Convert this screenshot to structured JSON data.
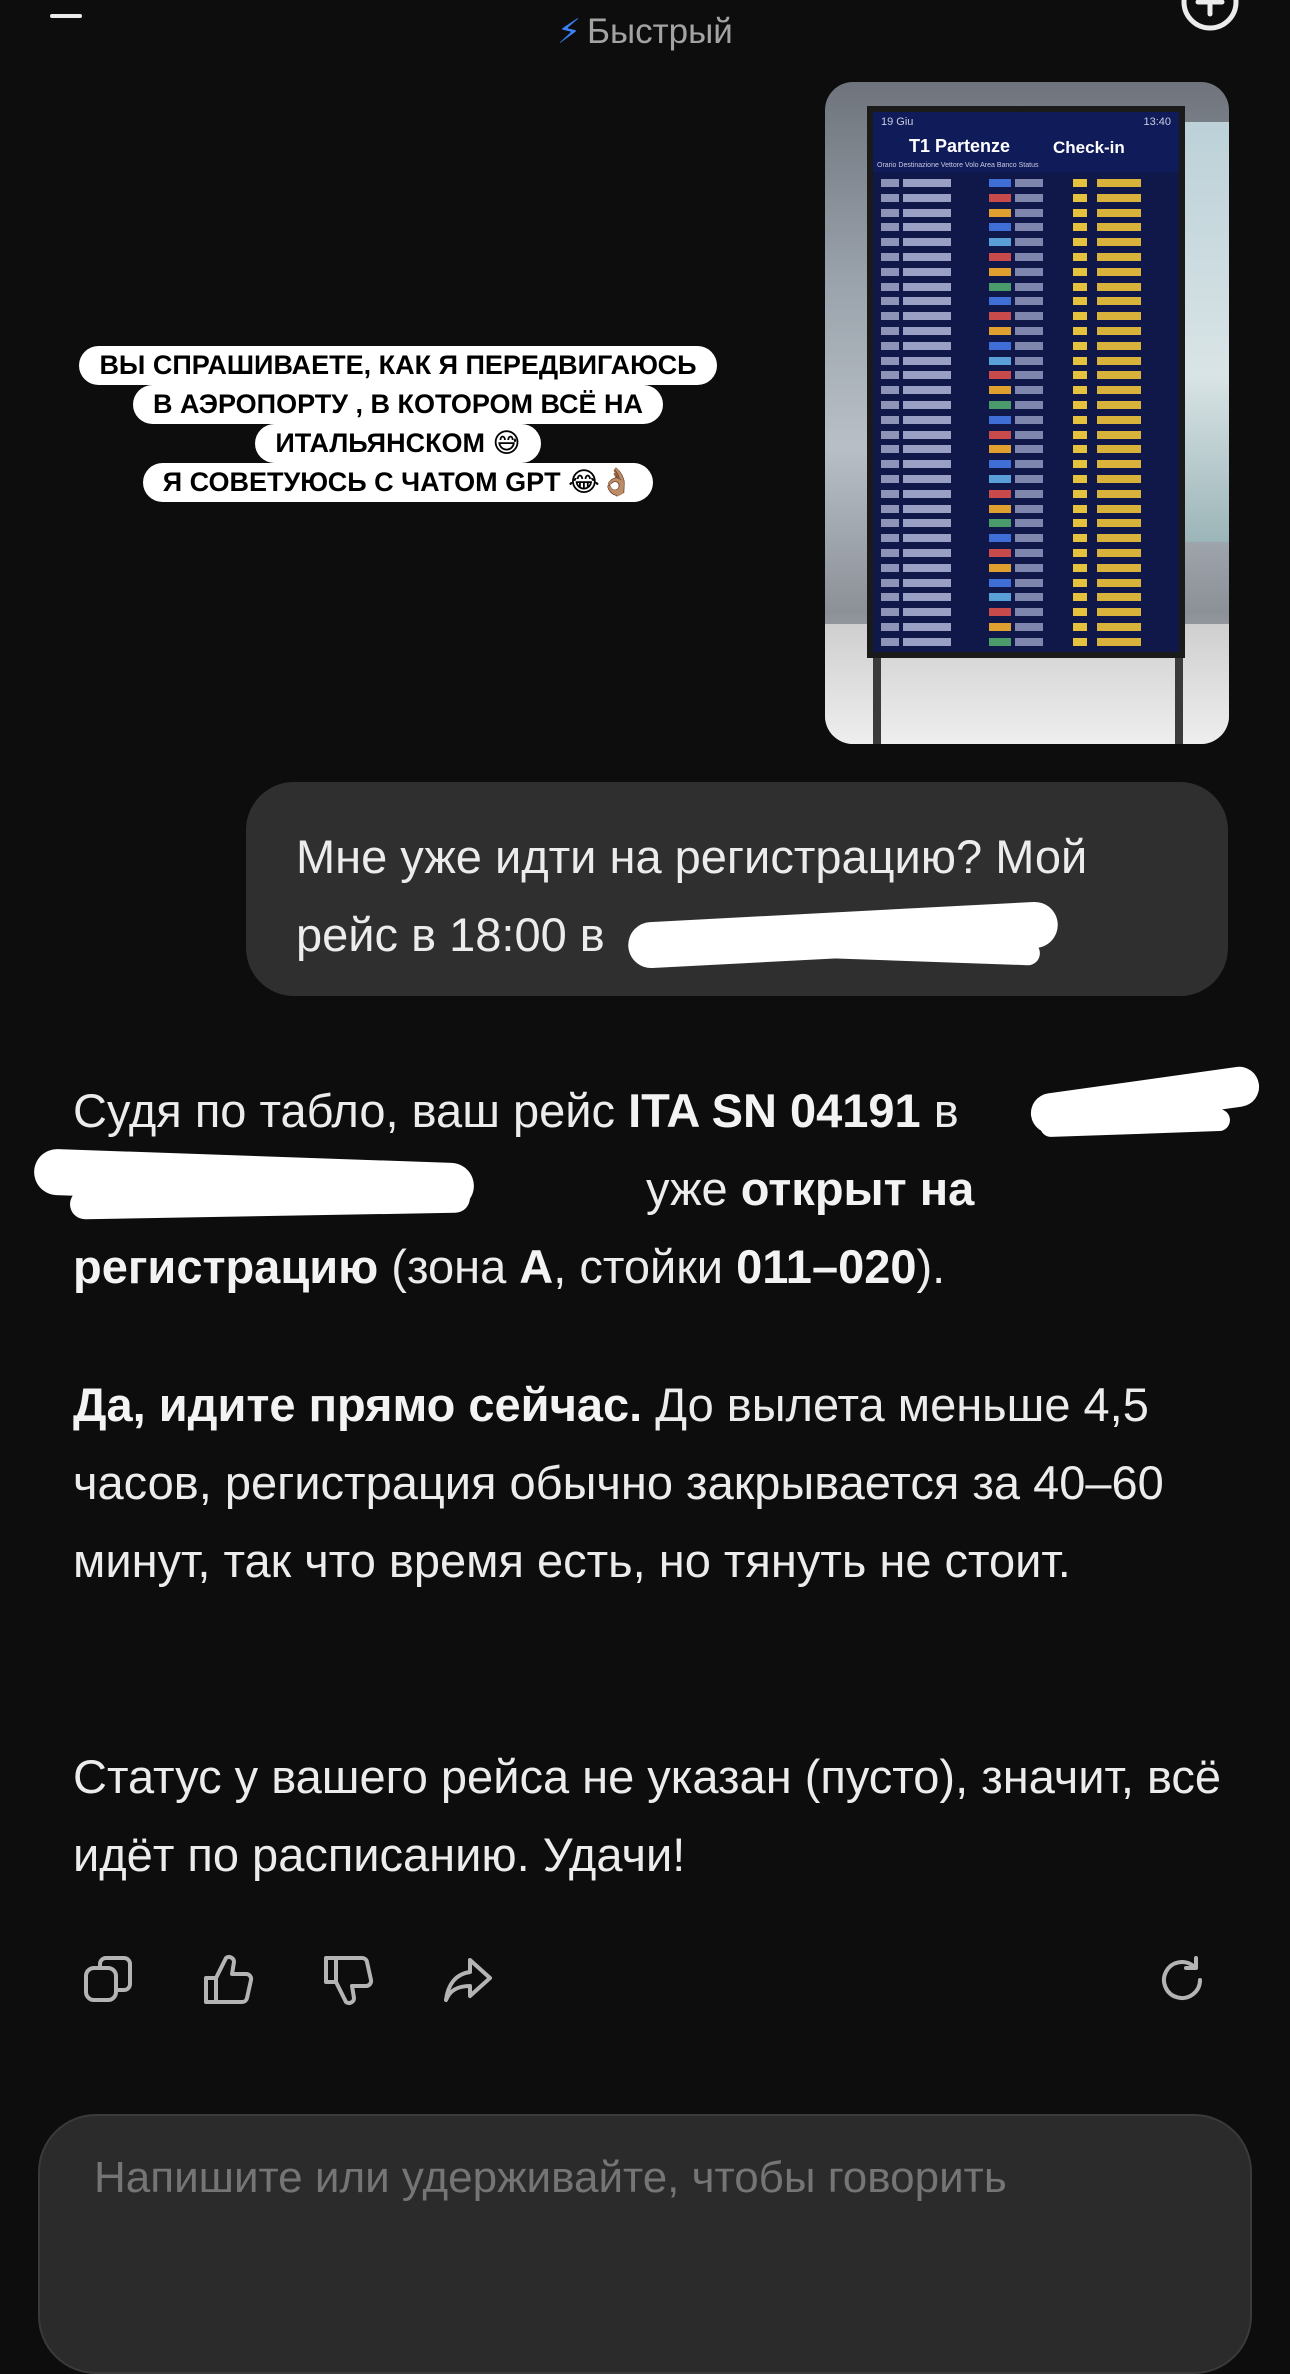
{
  "header": {
    "model_mode": "Быстрый"
  },
  "story_caption": {
    "lines": [
      "ВЫ СПРАШИВАЕТЕ, КАК Я ПЕРЕДВИГАЮСЬ",
      "В АЭРОПОРТУ , В КОТОРОМ ВСЁ НА",
      "ИТАЛЬЯНСКОМ 😅",
      "Я СОВЕТУЮСЬ С ЧАТОМ GPT 😂👌🏽"
    ]
  },
  "attached_image": {
    "board_date": "19 Giu",
    "board_time": "13:40",
    "board_title": "T1 Partenze",
    "board_checkin": "Check-in",
    "board_columns": "Orario  Destinazione     Vettore  Volo           Area  Banco  Status"
  },
  "user_message": {
    "text": "Мне уже идти на регистрацию? Мой рейс в 18:00 в"
  },
  "assistant_message": {
    "p1_a": "Судя по табло, ваш рейс ",
    "p1_b": "ITA SN 04191",
    "p1_c": " в ",
    "p1_d": " уже ",
    "p1_e": "открыт на регистрацию",
    "p1_f": " (зона ",
    "p1_g": "A",
    "p1_h": ", стойки ",
    "p1_i": "011–020",
    "p1_j": ").",
    "p2_a": "Да, идите прямо сейчас.",
    "p2_b": " До вылета меньше 4,5 часов, регистрация обычно закрывается за 40–60 минут, так что время есть, но тянуть не стоит.",
    "p3": "Статус у вашего рейса не указан (пусто), значит, всё идёт по расписанию. Удачи!"
  },
  "actions": [
    "copy-icon",
    "thumbs-up-icon",
    "thumbs-down-icon",
    "share-icon",
    "regenerate-icon"
  ],
  "composer": {
    "placeholder": "Напишите или удерживайте, чтобы говорить"
  },
  "colors": {
    "background": "#0d0d0d",
    "bubble": "#2f2f2f",
    "accent_bolt": "#3b82f6"
  }
}
